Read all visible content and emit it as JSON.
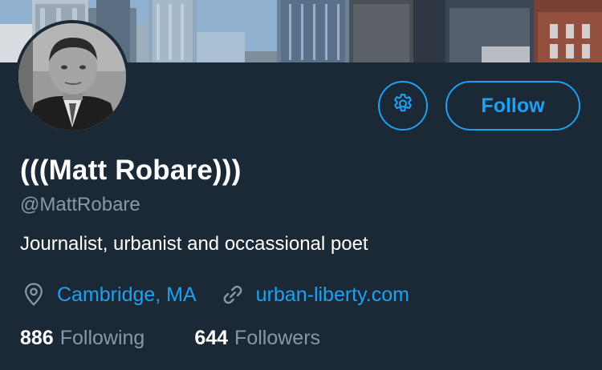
{
  "profile": {
    "display_name": "(((Matt Robare)))",
    "handle": "@MattRobare",
    "bio": "Journalist, urbanist and occassional poet",
    "location": "Cambridge, MA",
    "website": "urban-liberty.com",
    "following_count": "886",
    "following_label": "Following",
    "followers_count": "644",
    "followers_label": "Followers"
  },
  "actions": {
    "follow_label": "Follow"
  },
  "icons": {
    "settings": "gear-icon",
    "location": "location-pin-icon",
    "website": "link-icon"
  },
  "colors": {
    "background": "#1b2836",
    "accent": "#1da1f2",
    "secondary_text": "#8899a6",
    "primary_text": "#ffffff"
  }
}
